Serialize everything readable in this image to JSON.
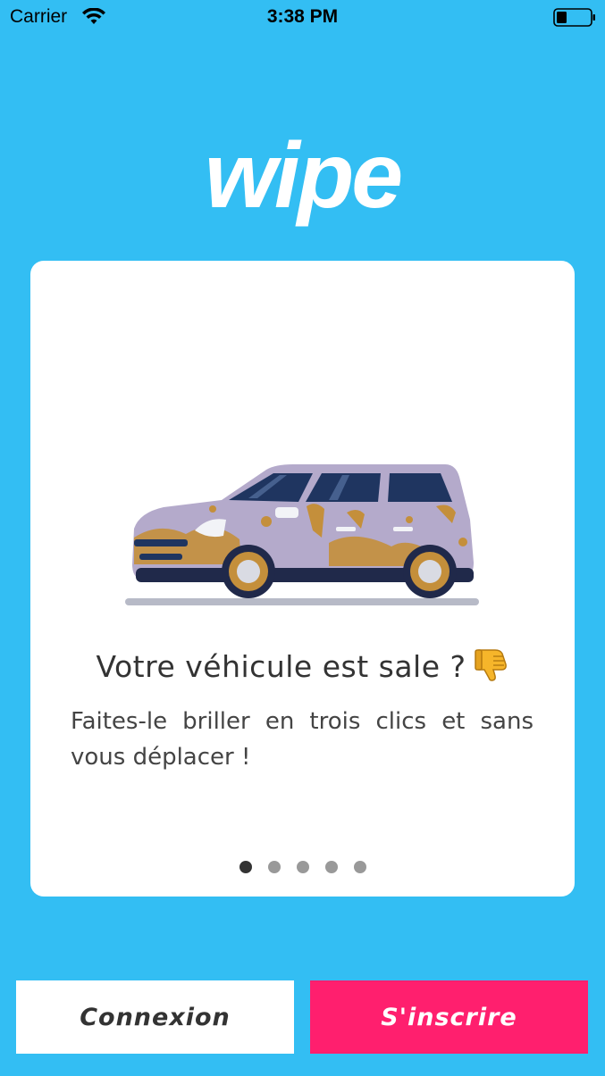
{
  "status_bar": {
    "carrier": "Carrier",
    "time": "3:38 PM",
    "wifi_icon": "wifi-icon",
    "battery_icon": "battery-icon"
  },
  "logo": "wipe",
  "onboarding": {
    "title": "Votre véhicule est sale ?",
    "title_icon": "thumbs-down-icon",
    "body": "Faites-le briller en trois clics et sans vous déplacer !",
    "illustration": "dirty-car-illustration",
    "pages": 5,
    "current_page": 1
  },
  "actions": {
    "login_label": "Connexion",
    "signup_label": "S'inscrire"
  },
  "colors": {
    "background": "#33BEF3",
    "signup": "#FF1F6E",
    "card": "#FFFFFF"
  }
}
